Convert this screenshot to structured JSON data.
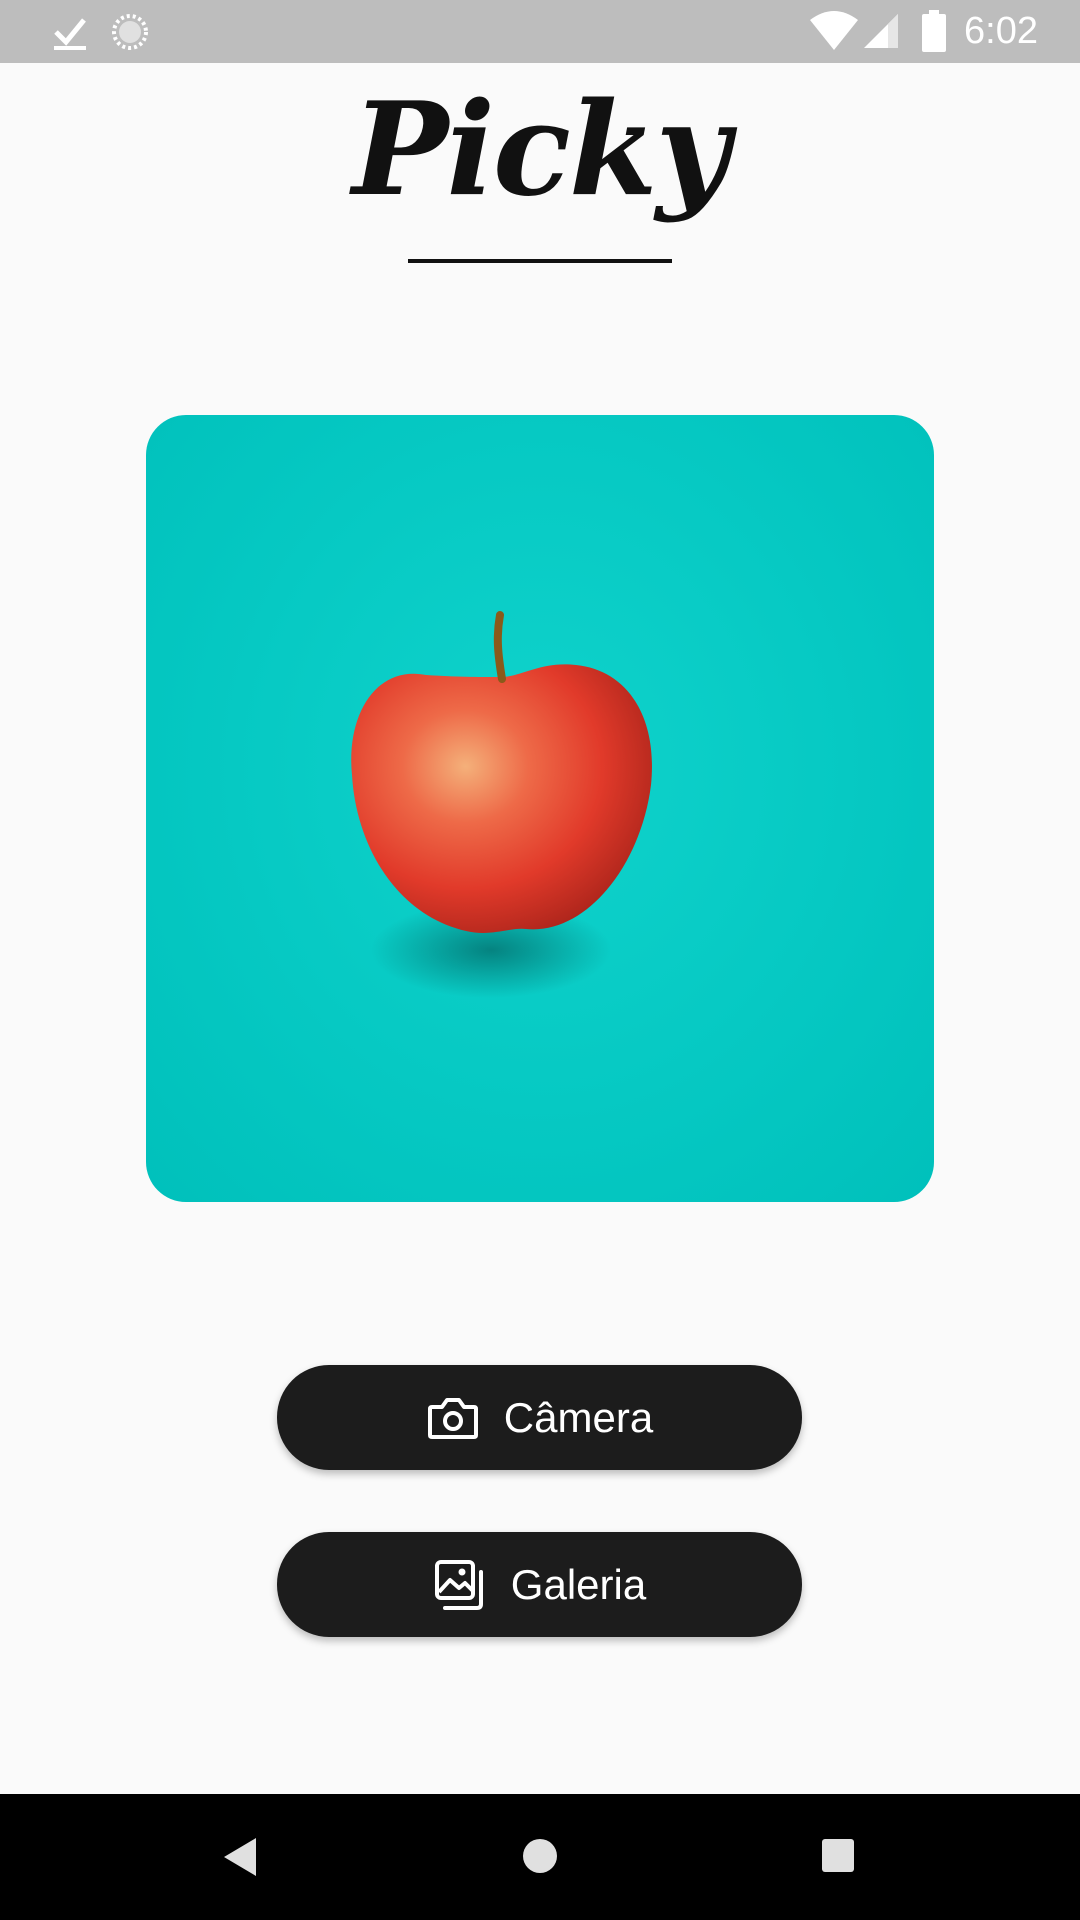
{
  "status_bar": {
    "time": "6:02",
    "icons": [
      "download-done-icon",
      "sync-icon",
      "wifi-icon",
      "cell-signal-icon",
      "battery-icon"
    ]
  },
  "header": {
    "title": "Picky"
  },
  "main": {
    "image": {
      "icon": "apple-photo",
      "background_color": "#06c9c3"
    },
    "buttons": [
      {
        "label": "Câmera",
        "icon": "camera-icon"
      },
      {
        "label": "Galeria",
        "icon": "gallery-icon"
      }
    ]
  },
  "nav_bar": {
    "icons": [
      "back-icon",
      "home-icon",
      "recents-icon"
    ]
  },
  "colors": {
    "background": "#fafafa",
    "status_bar": "#bdbdbd",
    "button": "#1c1c1c",
    "button_text": "#ffffff",
    "nav_bar": "#000000",
    "accent_teal": "#06c9c3"
  }
}
